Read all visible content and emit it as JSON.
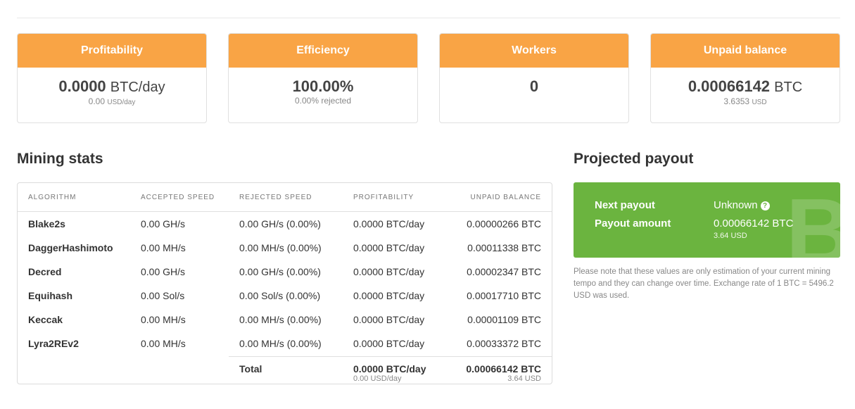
{
  "cards": [
    {
      "title": "Profitability",
      "value": "0.0000",
      "unit": "BTC/day",
      "sub_value": "0.00",
      "sub_unit": "USD/day"
    },
    {
      "title": "Efficiency",
      "value": "100.00%",
      "unit": "",
      "sub_value": "0.00% rejected",
      "sub_unit": ""
    },
    {
      "title": "Workers",
      "value": "0",
      "unit": "",
      "sub_value": "",
      "sub_unit": ""
    },
    {
      "title": "Unpaid balance",
      "value": "0.00066142",
      "unit": "BTC",
      "sub_value": "3.6353",
      "sub_unit": "USD"
    }
  ],
  "mining_stats": {
    "title": "Mining stats",
    "headers": [
      "ALGORITHM",
      "ACCEPTED SPEED",
      "REJECTED SPEED",
      "PROFITABILITY",
      "UNPAID BALANCE"
    ],
    "rows": [
      {
        "algorithm": "Blake2s",
        "accepted": "0.00 GH/s",
        "rejected": "0.00 GH/s (0.00%)",
        "profitability": "0.0000 BTC/day",
        "unpaid": "0.00000266 BTC"
      },
      {
        "algorithm": "DaggerHashimoto",
        "accepted": "0.00 MH/s",
        "rejected": "0.00 MH/s (0.00%)",
        "profitability": "0.0000 BTC/day",
        "unpaid": "0.00011338 BTC"
      },
      {
        "algorithm": "Decred",
        "accepted": "0.00 GH/s",
        "rejected": "0.00 GH/s (0.00%)",
        "profitability": "0.0000 BTC/day",
        "unpaid": "0.00002347 BTC"
      },
      {
        "algorithm": "Equihash",
        "accepted": "0.00 Sol/s",
        "rejected": "0.00 Sol/s (0.00%)",
        "profitability": "0.0000 BTC/day",
        "unpaid": "0.00017710 BTC"
      },
      {
        "algorithm": "Keccak",
        "accepted": "0.00 MH/s",
        "rejected": "0.00 MH/s (0.00%)",
        "profitability": "0.0000 BTC/day",
        "unpaid": "0.00001109 BTC"
      },
      {
        "algorithm": "Lyra2REv2",
        "accepted": "0.00 MH/s",
        "rejected": "0.00 MH/s (0.00%)",
        "profitability": "0.0000 BTC/day",
        "unpaid": "0.00033372 BTC"
      }
    ],
    "total": {
      "label": "Total",
      "profitability": "0.0000 BTC/day",
      "profitability_sub": "0.00 USD/day",
      "unpaid": "0.00066142 BTC",
      "unpaid_sub": "3.64 USD"
    }
  },
  "payout": {
    "title": "Projected payout",
    "next_label": "Next payout",
    "next_value": "Unknown",
    "amount_label": "Payout amount",
    "amount_value": "0.00066142 BTC",
    "amount_sub": "3.64 USD",
    "logo_glyph": "B",
    "note": "Please note that these values are only estimation of your current mining tempo and they can change over time. Exchange rate of 1 BTC = 5496.2 USD was used."
  },
  "colors": {
    "accent_orange": "#f9a445",
    "payout_green": "#6bb43f"
  }
}
